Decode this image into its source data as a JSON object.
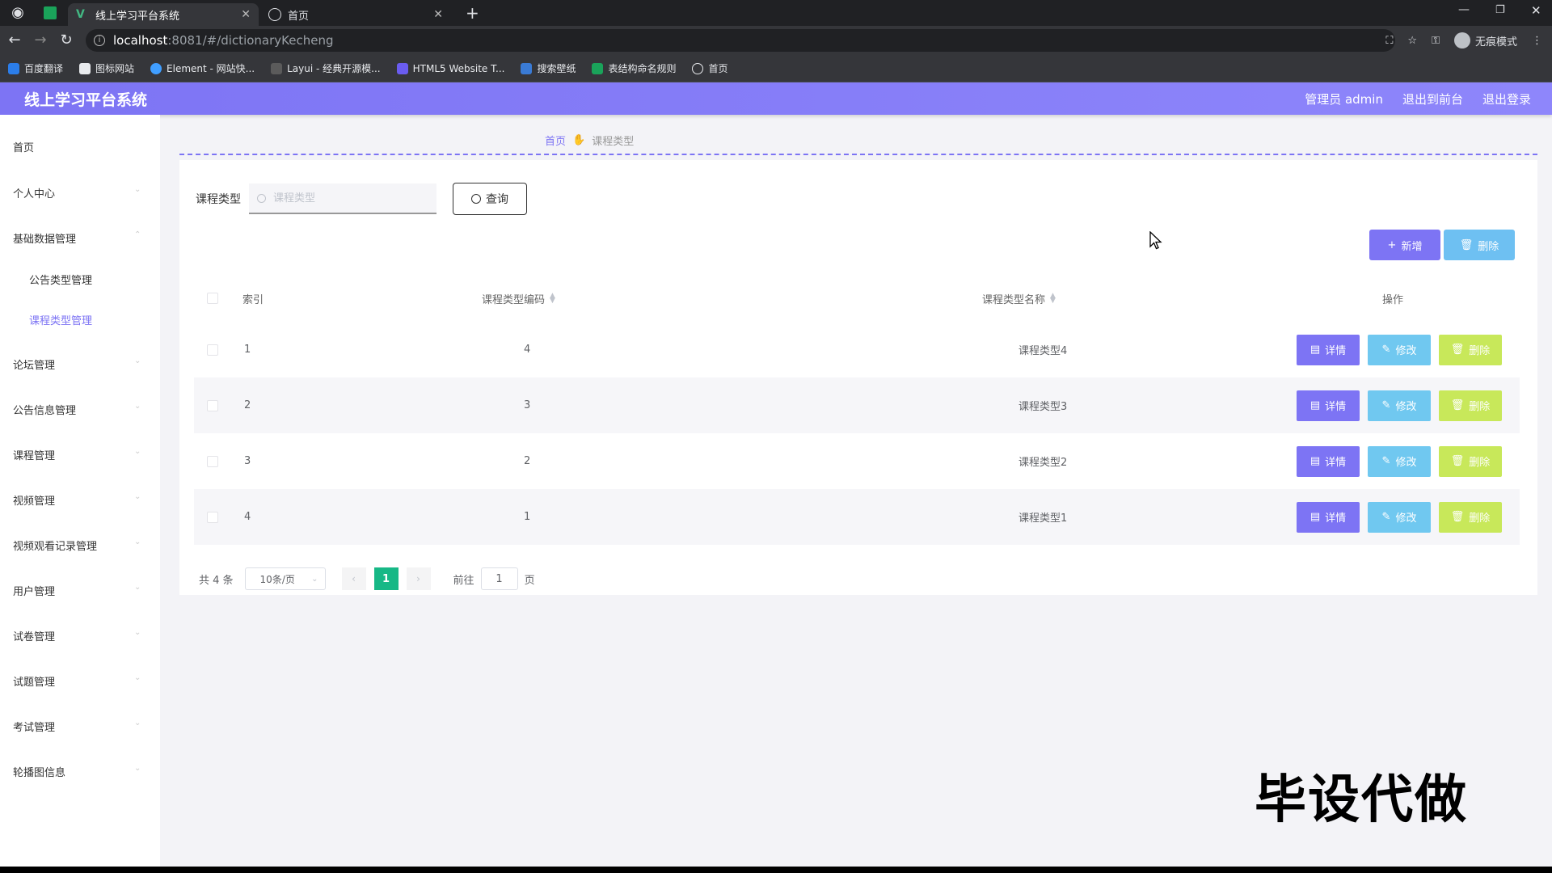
{
  "browser": {
    "tabs": [
      {
        "title": "线上学习平台系统",
        "active": true
      },
      {
        "title": "首页",
        "active": false
      }
    ],
    "url_host": "localhost",
    "url_rest": ":8081/#/dictionaryKecheng",
    "incognito_label": "无痕模式",
    "bookmarks": [
      "百度翻译",
      "图标网站",
      "Element - 网站快...",
      "Layui - 经典开源模...",
      "HTML5 Website T...",
      "搜索壁纸",
      "表结构命名规则",
      "首页"
    ]
  },
  "header": {
    "title": "线上学习平台系统",
    "user": "管理员 admin",
    "to_front": "退出到前台",
    "logout": "退出登录"
  },
  "sidebar": {
    "items": [
      {
        "label": "首页"
      },
      {
        "label": "个人中心"
      },
      {
        "label": "基础数据管理"
      },
      {
        "label": "公告类型管理"
      },
      {
        "label": "课程类型管理"
      },
      {
        "label": "论坛管理"
      },
      {
        "label": "公告信息管理"
      },
      {
        "label": "课程管理"
      },
      {
        "label": "视频管理"
      },
      {
        "label": "视频观看记录管理"
      },
      {
        "label": "用户管理"
      },
      {
        "label": "试卷管理"
      },
      {
        "label": "试题管理"
      },
      {
        "label": "考试管理"
      },
      {
        "label": "轮播图信息"
      }
    ]
  },
  "breadcrumb": {
    "home": "首页",
    "current": "课程类型"
  },
  "search": {
    "label": "课程类型",
    "placeholder": "课程类型",
    "button": "查询"
  },
  "actions": {
    "add": "新增",
    "delete": "删除"
  },
  "table": {
    "headers": [
      "索引",
      "课程类型编码",
      "课程类型名称",
      "操作"
    ],
    "rows": [
      {
        "index": "1",
        "code": "4",
        "name": "课程类型4"
      },
      {
        "index": "2",
        "code": "3",
        "name": "课程类型3"
      },
      {
        "index": "3",
        "code": "2",
        "name": "课程类型2"
      },
      {
        "index": "4",
        "code": "1",
        "name": "课程类型1"
      }
    ],
    "row_actions": {
      "detail": "详情",
      "edit": "修改",
      "delete": "删除"
    }
  },
  "pager": {
    "total": "共 4 条",
    "page_size": "10条/页",
    "current_page": "1",
    "goto_prefix": "前往",
    "goto_value": "1",
    "goto_suffix": "页"
  },
  "watermark": "毕设代做",
  "colors": {
    "accent": "#7d74f4",
    "info": "#70c8f0",
    "warn": "#c8e85a",
    "page_active": "#17b886"
  }
}
